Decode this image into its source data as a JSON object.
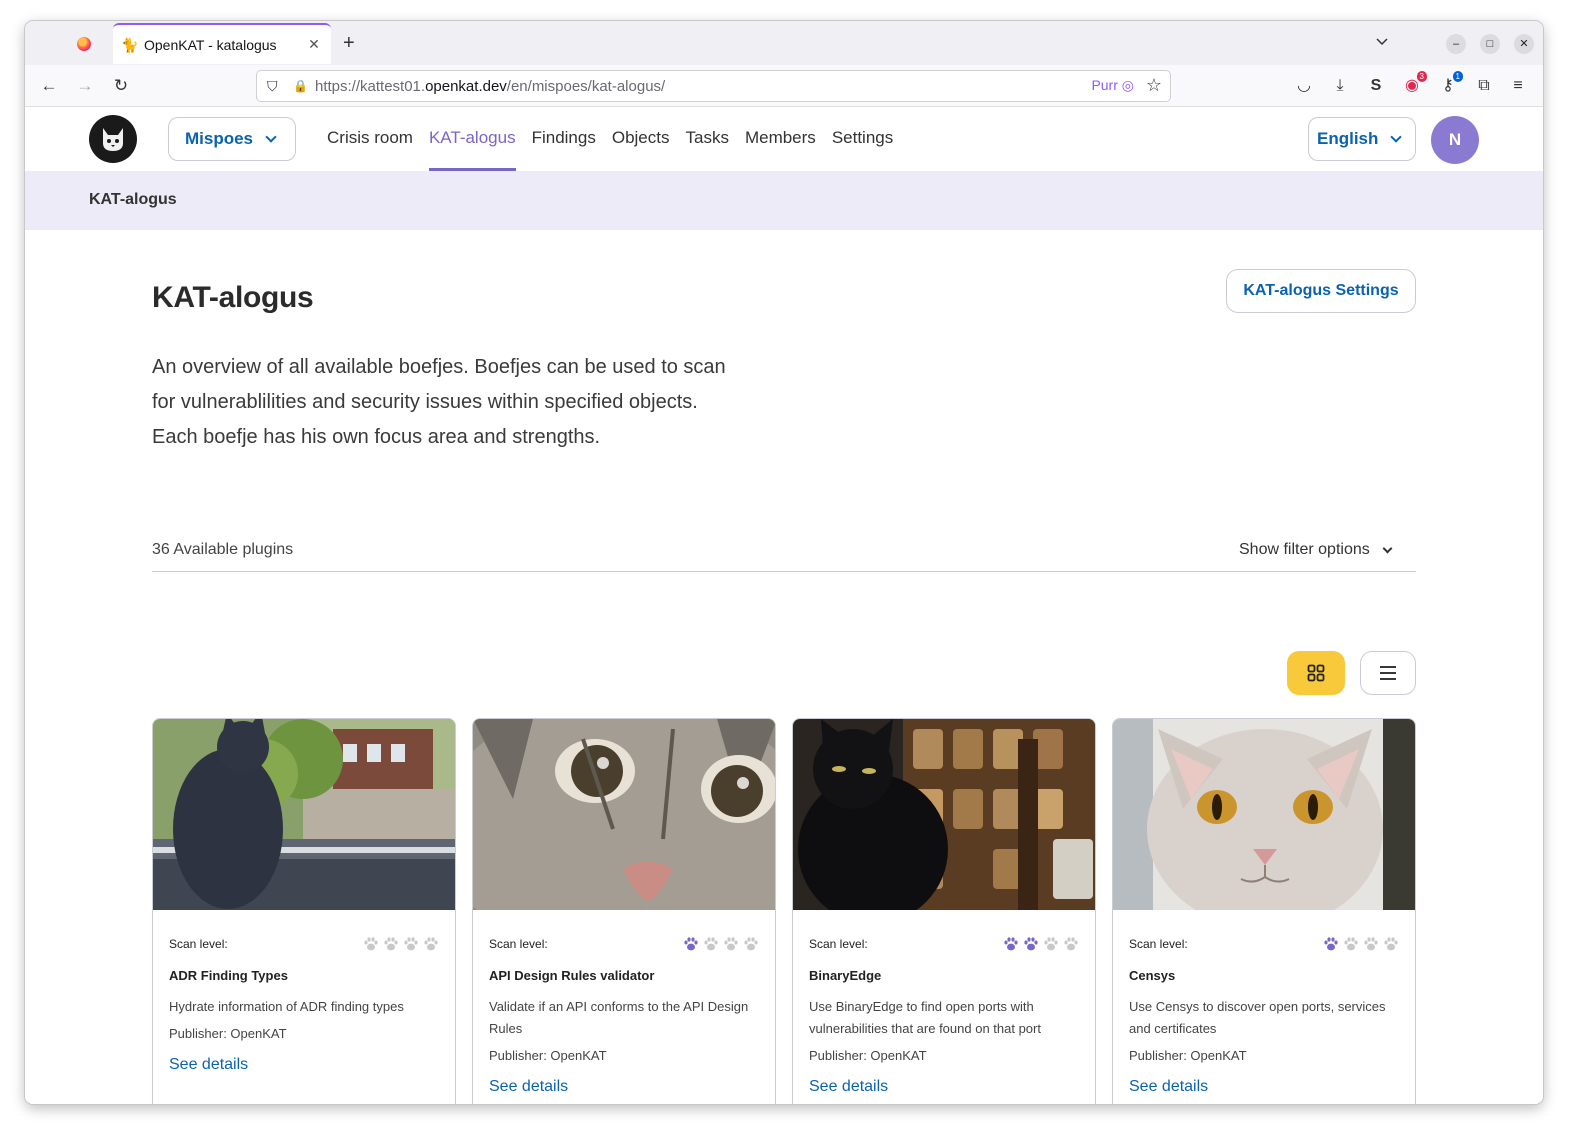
{
  "browser": {
    "tab_title": "OpenKAT - katalogus",
    "url_prefix": "https://kattest01.",
    "url_domain": "openkat.dev",
    "url_path": "/en/mispoes/kat-alogus/",
    "url_extension_label": "Purr",
    "badge_count": "3",
    "badge_count2": "1"
  },
  "header": {
    "org_name": "Mispoes",
    "nav": [
      "Crisis room",
      "KAT-alogus",
      "Findings",
      "Objects",
      "Tasks",
      "Members",
      "Settings"
    ],
    "active_nav": "KAT-alogus",
    "language": "English",
    "avatar_initial": "N"
  },
  "breadcrumb": "KAT-alogus",
  "main": {
    "title": "KAT-alogus",
    "settings_button": "KAT-alogus Settings",
    "intro_lines": [
      "An overview of all available boefjes. Boefjes can be used to scan",
      "for vulnerablilities and security issues within specified objects.",
      "Each boefje has his own focus area and strengths."
    ],
    "plugins_count": "36 Available plugins",
    "filter_toggle": "Show filter options"
  },
  "colors": {
    "accent_purple": "#7a66c9",
    "link_blue": "#0b63b0",
    "grid_button_yellow": "#f8c93a",
    "breadcrumb_bg": "#ecebf7"
  },
  "cards": [
    {
      "scan_label": "Scan level:",
      "scan_level": 0,
      "title": "ADR Finding Types",
      "description": "Hydrate information of ADR finding types",
      "publisher": "Publisher: OpenKAT",
      "link": "See details"
    },
    {
      "scan_label": "Scan level:",
      "scan_level": 1,
      "title": "API Design Rules validator",
      "description": "Validate if an API conforms to the API Design Rules",
      "publisher": "Publisher: OpenKAT",
      "link": "See details"
    },
    {
      "scan_label": "Scan level:",
      "scan_level": 2,
      "title": "BinaryEdge",
      "description": "Use BinaryEdge to find open ports with vulnerabilities that are found on that port",
      "publisher": "Publisher: OpenKAT",
      "link": "See details"
    },
    {
      "scan_label": "Scan level:",
      "scan_level": 1,
      "title": "Censys",
      "description": "Use Censys to discover open ports, services and certificates",
      "publisher": "Publisher: OpenKAT",
      "link": "See details"
    }
  ]
}
